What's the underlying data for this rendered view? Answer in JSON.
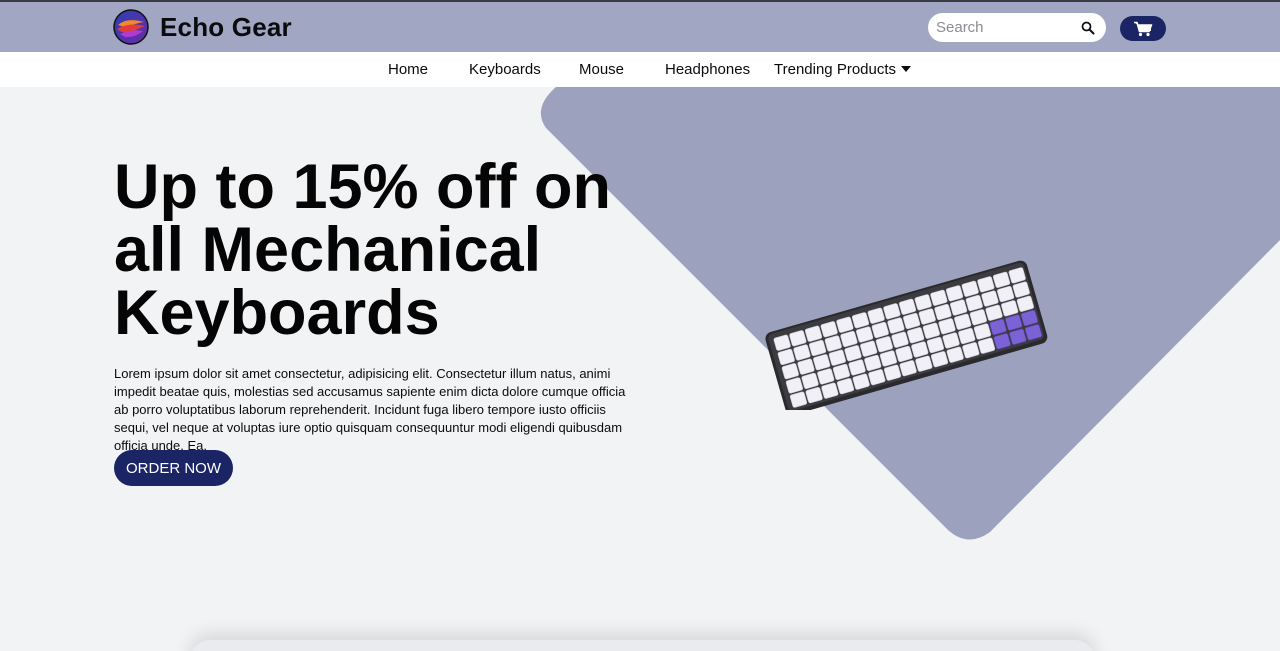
{
  "brand": {
    "name": "Echo Gear"
  },
  "search": {
    "placeholder": "Search"
  },
  "nav": {
    "items": [
      {
        "label": "Home"
      },
      {
        "label": "Keyboards"
      },
      {
        "label": "Mouse"
      },
      {
        "label": "Headphones"
      },
      {
        "label": "Trending Products"
      }
    ]
  },
  "hero": {
    "headline_lines": [
      "Up to 15% off on",
      "all Mechanical",
      "Keyboards"
    ],
    "body": "Lorem ipsum dolor sit amet consectetur, adipisicing elit. Consectetur illum natus, animi impedit beatae quis, molestias sed accusamus sapiente enim dicta dolore cumque officia ab porro voluptatibus laborum reprehenderit. Incidunt fuga libero tempore iusto officiis sequi, vel neque at voluptas iure optio quisquam consequuntur modi eligendi quibusdam officia unde. Ea.",
    "cta_label": "ORDER NOW"
  },
  "icons": {
    "logo": "echo-gear-logo",
    "search": "search-icon",
    "cart": "cart-icon",
    "dropdown": "caret-down-icon",
    "hero_image": "mechanical-keyboard-image"
  },
  "colors": {
    "topbar": "#a1a7c2",
    "accent": "#1b2566",
    "hero_shape": "#9ca1bd",
    "page_background": "#f2f3f5"
  }
}
